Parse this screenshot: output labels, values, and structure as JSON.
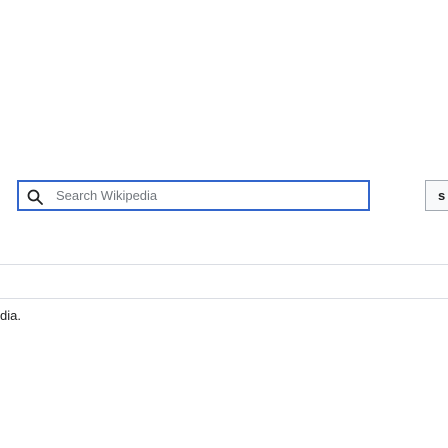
{
  "search": {
    "placeholder": "Search Wikipedia",
    "icon": "search-icon",
    "button_label_fragment": "s"
  },
  "footer": {
    "text_fragment": "dia."
  },
  "colors": {
    "search_focus_border": "#3366cc",
    "placeholder_text": "#72777d",
    "divider": "#dadde3"
  }
}
